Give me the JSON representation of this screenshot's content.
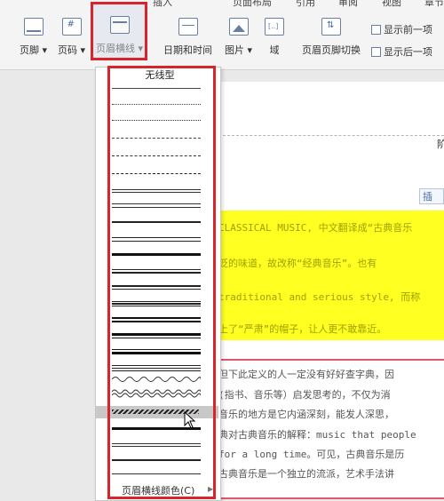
{
  "ribbon": {
    "tabs": [
      "插入",
      "页面布局",
      "引用",
      "审阅",
      "视图",
      "章节"
    ],
    "buttons": {
      "footer": "页脚",
      "page_number": "页码",
      "header_line": "页眉横线",
      "datetime": "日期和时间",
      "picture": "图片",
      "field": "域",
      "switch": "页眉页脚切换",
      "show_prev": "显示前一项",
      "show_next": "显示后一项"
    }
  },
  "dropdown": {
    "no_line": "无线型",
    "footer_label": "页眉横线颜色(C)"
  },
  "document": {
    "partial_header": "阶",
    "insert_label": "插",
    "yellow_lines": [
      "CLASSICAL MUSIC, 中文翻译成“古典音乐",
      "贬的味道，故改称“经典音乐”。也有",
      "traditional and serious style, 而称",
      "上了“严肃”的帽子，让人更不敢靠近。"
    ],
    "box_lines": [
      "但下此定义的人一定没有好好查字典，因",
      "(指书、音乐等）启发思考的，不仅为消",
      "音乐的地方是它内涵深刻，能发人深思，",
      "典对古典音乐的解释：music that people",
      "for a long time。可见，古典音乐是历",
      "古典音乐是一个独立的流派，艺术手法讲"
    ]
  },
  "colors": {
    "highlight_frame": "#d9242c",
    "yellow": "#ffff22",
    "box_border": "#e0566e"
  }
}
